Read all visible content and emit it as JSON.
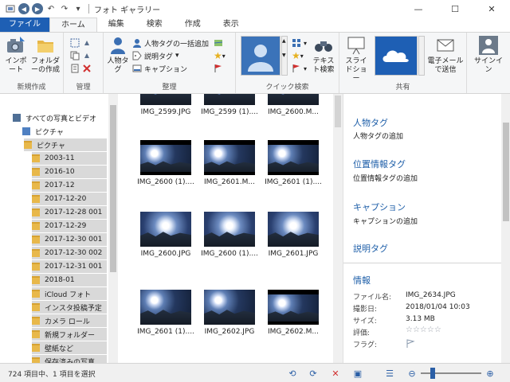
{
  "window": {
    "title": "フォト ギャラリー",
    "minimize_glyph": "—",
    "maximize_glyph": "☐",
    "close_glyph": "✕"
  },
  "ribbon_tabs": [
    "ファイル",
    "ホーム",
    "編集",
    "検索",
    "作成",
    "表示"
  ],
  "ribbon": {
    "new_group": {
      "label": "新規作成",
      "import_label": "インポート",
      "folder_label": "フォルダーの作成"
    },
    "manage_group": {
      "label": "管理"
    },
    "organize_group": {
      "label": "整理",
      "people_tag": "人物タグ",
      "batch_people_tag": "人物タグの一括追加",
      "description_tag": "説明タグ",
      "caption": "キャプション"
    },
    "quick_find_group": {
      "label": "クイック検索",
      "text_search": "テキスト検索"
    },
    "share_group": {
      "label": "共有",
      "slideshow": "スライドショー",
      "email": "電子メールで送信"
    },
    "signin_label": "サインイン"
  },
  "nav": {
    "items": [
      {
        "label": "すべての写真とビデオ",
        "level": 0
      },
      {
        "label": "ピクチャ",
        "level": 1
      },
      {
        "label": "ピクチャ",
        "level": 2
      },
      {
        "label": "2003-11",
        "level": 3
      },
      {
        "label": "2016-10",
        "level": 3
      },
      {
        "label": "2017-12",
        "level": 3
      },
      {
        "label": "2017-12-20",
        "level": 3
      },
      {
        "label": "2017-12-28 001",
        "level": 3
      },
      {
        "label": "2017-12-29",
        "level": 3
      },
      {
        "label": "2017-12-30 001",
        "level": 3
      },
      {
        "label": "2017-12-30 002",
        "level": 3
      },
      {
        "label": "2017-12-31 001",
        "level": 3
      },
      {
        "label": "2018-01",
        "level": 3
      },
      {
        "label": "iCloud フォト",
        "level": 3
      },
      {
        "label": "インスタ投稿予定",
        "level": 3
      },
      {
        "label": "カメラ ロール",
        "level": 3
      },
      {
        "label": "新規フォルダー",
        "level": 3
      },
      {
        "label": "壁紙など",
        "level": 3
      },
      {
        "label": "保存済みの写真",
        "level": 3
      }
    ]
  },
  "gallery": {
    "items": [
      {
        "caption": "IMG_2599.JPG",
        "video": false
      },
      {
        "caption": "IMG_2599 (1)....",
        "video": false
      },
      {
        "caption": "IMG_2600.M...",
        "video": false
      },
      {
        "caption": "IMG_2600 (1)....",
        "video": true
      },
      {
        "caption": "IMG_2601.M...",
        "video": true
      },
      {
        "caption": "IMG_2601 (1)....",
        "video": true
      },
      {
        "caption": "IMG_2600.JPG",
        "video": false
      },
      {
        "caption": "IMG_2600 (1)....",
        "video": false
      },
      {
        "caption": "IMG_2601.JPG",
        "video": false
      },
      {
        "caption": "IMG_2601 (1)....",
        "video": false
      },
      {
        "caption": "IMG_2602.JPG",
        "video": false
      },
      {
        "caption": "IMG_2602.M...",
        "video": true
      }
    ]
  },
  "details": {
    "people_tag_heading": "人物タグ",
    "people_tag_add": "人物タグの追加",
    "geotag_heading": "位置情報タグ",
    "geotag_add": "位置情報タグの追加",
    "caption_heading": "キャプション",
    "caption_add": "キャプションの追加",
    "description_heading": "説明タグ",
    "info_heading": "情報",
    "info": {
      "filename_label": "ファイル名:",
      "filename": "IMG_2634.JPG",
      "date_label": "撮影日:",
      "date": "2018/01/04  10:03",
      "size_label": "サイズ:",
      "size": "3.13 MB",
      "rating_label": "評価:",
      "rating": "☆☆☆☆☆",
      "flag_label": "フラグ:"
    }
  },
  "status": {
    "text": "724 項目中、1 項目を選択"
  },
  "colors": {
    "file_tab": "#1e5fb4",
    "heading_blue": "#1d5ea8",
    "folder_yellow": "#e8b84a"
  }
}
